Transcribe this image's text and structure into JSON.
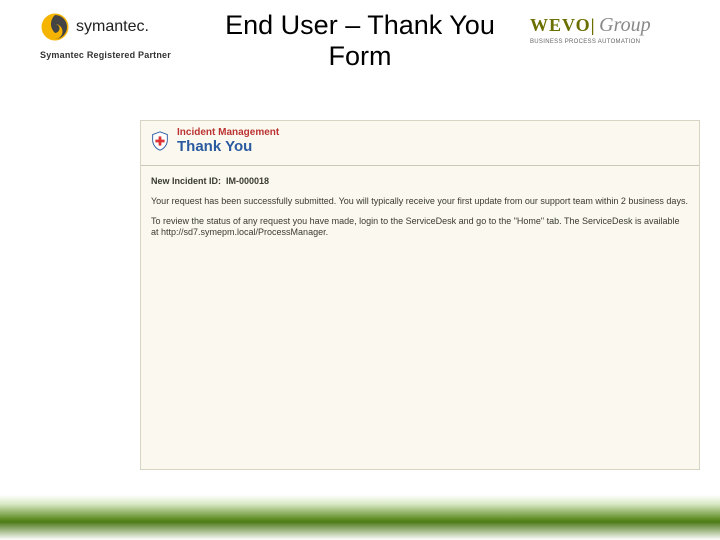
{
  "header": {
    "symantec_name": "symantec.",
    "symantec_tagline": "Symantec Registered Partner",
    "title_line1": "End User – Thank You",
    "title_line2": "Form",
    "wevo_part1": "WEVO",
    "wevo_sep": "|",
    "wevo_part2": "Group",
    "wevo_sub": "BUSINESS PROCESS AUTOMATION"
  },
  "panel": {
    "breadcrumb": "Incident Management",
    "heading": "Thank You",
    "new_incident_label": "New Incident ID:",
    "new_incident_id": "IM-000018",
    "para1": "Your request has been successfully submitted. You will typically receive your first update from our support team within 2 business days.",
    "para2": "To review the status of any request you have made, login to the ServiceDesk and go to the \"Home\" tab. The ServiceDesk is available at http://sd7.symepm.local/ProcessManager."
  }
}
